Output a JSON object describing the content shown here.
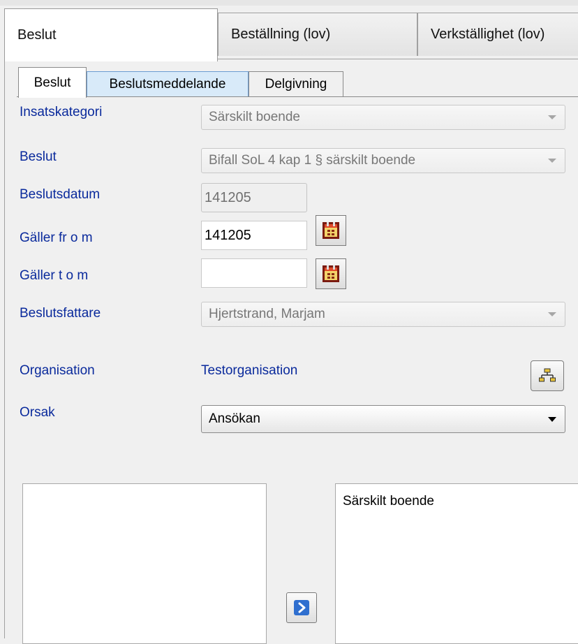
{
  "tabs": [
    {
      "label": "Beslut",
      "active": true
    },
    {
      "label": "Beställning (lov)",
      "active": false
    },
    {
      "label": "Verkställighet (lov)",
      "active": false
    }
  ],
  "subtabs": [
    {
      "label": "Beslut",
      "active": true
    },
    {
      "label": "Beslutsmeddelande",
      "active": false
    },
    {
      "label": "Delgivning",
      "active": false
    }
  ],
  "form": {
    "insatskategori": {
      "label": "Insatskategori",
      "value": "Särskilt boende"
    },
    "beslut": {
      "label": "Beslut",
      "value": "Bifall SoL 4 kap 1 § särskilt boende"
    },
    "beslutsdatum": {
      "label": "Beslutsdatum",
      "value": "141205"
    },
    "galler_from": {
      "label": "Gäller fr o m",
      "value": "141205"
    },
    "galler_tom": {
      "label": "Gäller t o m",
      "value": ""
    },
    "beslutsfattare": {
      "label": "Beslutsfattare",
      "value": "Hjertstrand, Marjam"
    },
    "organisation": {
      "label": "Organisation",
      "value": "Testorganisation"
    },
    "orsak": {
      "label": "Orsak",
      "value": "Ansökan"
    }
  },
  "lists": {
    "available": [],
    "selected": [
      "Särskilt boende"
    ]
  },
  "icons": {
    "calendar": "calendar-icon",
    "organisation": "org-chart-icon",
    "move": "arrow-right-icon"
  },
  "colors": {
    "label_blue": "#0a2a9c",
    "highlight_tab": "#d8eaf9"
  }
}
